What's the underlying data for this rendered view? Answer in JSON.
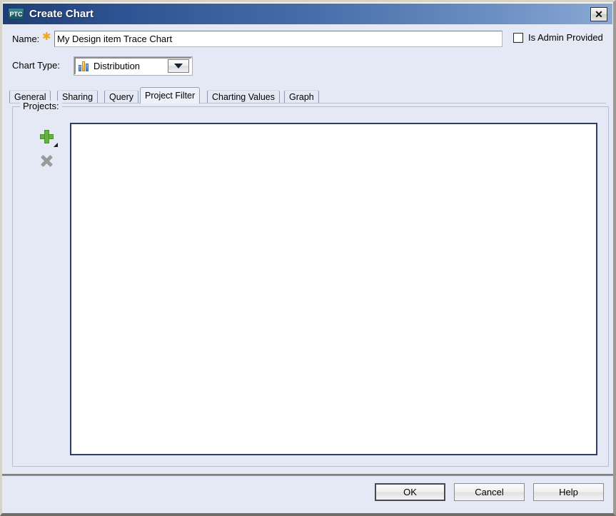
{
  "window": {
    "title": "Create Chart",
    "logo_text": "PTC",
    "close_label": "✕",
    "close_icon": "close-icon"
  },
  "form": {
    "name_label": "Name:",
    "required_marker": "✱",
    "name_value": "My Design item Trace Chart",
    "name_placeholder": "",
    "admin_checkbox_label": "Is Admin Provided",
    "admin_checkbox_checked": false,
    "charttype_label": "Chart Type:",
    "charttype_value": "Distribution",
    "charttype_icon": "bar-chart-icon",
    "charttype_arrow_icon": "chevron-down-icon"
  },
  "tabs": [
    {
      "label": "General",
      "selected": false
    },
    {
      "label": "Sharing",
      "selected": false
    },
    {
      "label": "Query",
      "selected": false
    },
    {
      "label": "Project Filter",
      "selected": true
    },
    {
      "label": "Charting Values",
      "selected": false
    },
    {
      "label": "Graph",
      "selected": false
    }
  ],
  "projects_panel": {
    "legend": "Projects:",
    "add_icon": "add-plus-icon",
    "remove_icon": "remove-x-icon",
    "list_items": []
  },
  "footer": {
    "ok_label": "OK",
    "cancel_label": "Cancel",
    "help_label": "Help"
  },
  "colors": {
    "title_bar_start": "#1f3e73",
    "title_bar_end": "#8aa8d4",
    "dialog_background": "#e4e9f5",
    "accent_green": "#63b33f",
    "required_star": "#f0a81e",
    "list_border": "#2b3f6b",
    "logo_teal": "#1f6673"
  }
}
